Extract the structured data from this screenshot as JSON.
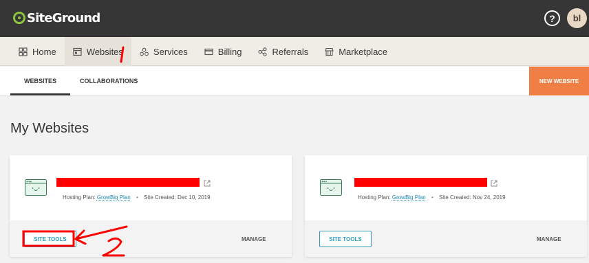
{
  "header": {
    "logo_text": "SiteGround",
    "help_symbol": "?",
    "avatar_initials": "bl"
  },
  "nav": {
    "items": [
      {
        "label": "Home",
        "icon": "grid-icon"
      },
      {
        "label": "Websites",
        "icon": "browser-icon",
        "active": true
      },
      {
        "label": "Services",
        "icon": "services-icon"
      },
      {
        "label": "Billing",
        "icon": "card-icon"
      },
      {
        "label": "Referrals",
        "icon": "share-icon"
      },
      {
        "label": "Marketplace",
        "icon": "store-icon"
      }
    ]
  },
  "subnav": {
    "tabs": [
      "WEBSITES",
      "COLLABORATIONS"
    ],
    "new_website": "NEW WEBSITE"
  },
  "page": {
    "title": "My Websites"
  },
  "sites": [
    {
      "hosting_label": "Hosting Plan:",
      "plan": "GrowBig Plan",
      "created_label": "Site Created:",
      "created": "Dec 10, 2019",
      "tools_label": "SITE TOOLS",
      "manage_label": "MANAGE"
    },
    {
      "hosting_label": "Hosting Plan:",
      "plan": "GrowBig Plan",
      "created_label": "Site Created:",
      "created": "Nov 24, 2019",
      "tools_label": "SITE TOOLS",
      "manage_label": "MANAGE"
    }
  ],
  "annotations": {
    "one": "1",
    "two": "2"
  },
  "colors": {
    "topbar": "#363636",
    "accent_orange": "#ef7f45",
    "link_blue": "#2f9cc0",
    "logo_green": "#8cc63f",
    "annotation_red": "#ff0000"
  }
}
